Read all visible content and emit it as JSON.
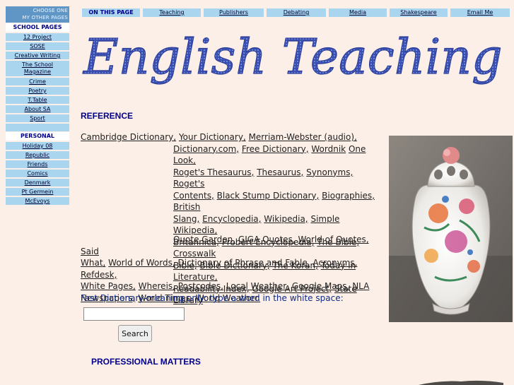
{
  "sidebar": {
    "header": [
      "CHOOSE ONE",
      "MY OTHER PAGES"
    ],
    "school_title": "SCHOOL PAGES",
    "school_items": [
      "12 Project",
      "SOSE",
      "Creative Writing",
      "The School",
      "Magazine",
      "Crime",
      "Poetry",
      "T.Table",
      "About SA",
      "Sport"
    ],
    "personal_title": "PERSONAL",
    "personal_items": [
      "Holiday 08",
      "Republic",
      "Friends",
      "Comics",
      "Denmark",
      "Pt Germein",
      "McEvoys"
    ]
  },
  "topnav": {
    "active": "ON THIS PAGE",
    "items": [
      "Teaching",
      "Publishers",
      "Debating",
      "Media",
      "Shakespeare",
      "Email Me"
    ]
  },
  "logo": {
    "text": "English Teaching"
  },
  "reference": {
    "heading": "REFERENCE",
    "lines": [
      [
        "Cambridge Dictionary,",
        "Your Dictionary,",
        "Merriam-Webster (audio),"
      ],
      [
        "Dictionary.com,",
        "Free Dictionary,",
        "Wordnik",
        "One Look,"
      ],
      [
        "Roget's Thesaurus,",
        "Thesaurus,",
        "Synonyms,",
        "Roget's"
      ],
      [
        "Contents,",
        "Black Stump Dictionary,",
        "Biographies,",
        "British"
      ],
      [
        "Slang,",
        "Encyclopedia,",
        "Wikipedia,",
        "Simple Wikipedia,"
      ],
      [
        "Britannica,",
        "Probert Encyclopedia,",
        "The Bible,",
        "Crosswalk"
      ],
      [
        "Bible,",
        "Bible Dictionary,",
        "The Koran,",
        "Today in Literature,"
      ],
      [
        "Readability Index,",
        "Google Art Project,",
        "State Library"
      ]
    ],
    "quotes_lines": [
      [
        "Quote Garden,",
        "GIGA Quotes,",
        "World of Quotes,",
        "Said"
      ],
      [
        "What,",
        "World of Words,",
        "Dictionary of Phrase and Fable,",
        "Acronyms,",
        "Refdesk,"
      ],
      [
        "White Pages,",
        "Whereis,",
        "Postcodes,",
        "Local Weather,",
        "Google Maps,",
        "NLA"
      ],
      [
        "Newspapers,",
        "World Times,",
        "World Weather."
      ]
    ]
  },
  "fast_dictionary": {
    "label": "Fast Dictionary-meaning only: type a word in the white space:",
    "input_value": "",
    "button": "Search"
  },
  "professional": {
    "heading": "PROFESSIONAL MATTERS"
  },
  "colors": {
    "background": "#fcefe7",
    "nav_bg": "#a9d6ee",
    "sidebar_header": "#5f96c6",
    "heading": "#00008b",
    "logo": "#3a4fb0"
  }
}
